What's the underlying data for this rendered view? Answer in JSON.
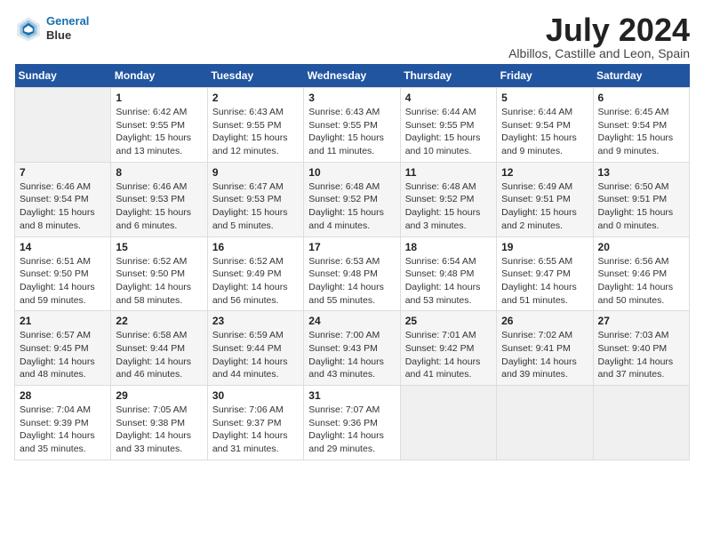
{
  "header": {
    "logo_line1": "General",
    "logo_line2": "Blue",
    "month_title": "July 2024",
    "location": "Albillos, Castille and Leon, Spain"
  },
  "days_of_week": [
    "Sunday",
    "Monday",
    "Tuesday",
    "Wednesday",
    "Thursday",
    "Friday",
    "Saturday"
  ],
  "weeks": [
    [
      {
        "day": "",
        "info": ""
      },
      {
        "day": "1",
        "info": "Sunrise: 6:42 AM\nSunset: 9:55 PM\nDaylight: 15 hours\nand 13 minutes."
      },
      {
        "day": "2",
        "info": "Sunrise: 6:43 AM\nSunset: 9:55 PM\nDaylight: 15 hours\nand 12 minutes."
      },
      {
        "day": "3",
        "info": "Sunrise: 6:43 AM\nSunset: 9:55 PM\nDaylight: 15 hours\nand 11 minutes."
      },
      {
        "day": "4",
        "info": "Sunrise: 6:44 AM\nSunset: 9:55 PM\nDaylight: 15 hours\nand 10 minutes."
      },
      {
        "day": "5",
        "info": "Sunrise: 6:44 AM\nSunset: 9:54 PM\nDaylight: 15 hours\nand 9 minutes."
      },
      {
        "day": "6",
        "info": "Sunrise: 6:45 AM\nSunset: 9:54 PM\nDaylight: 15 hours\nand 9 minutes."
      }
    ],
    [
      {
        "day": "7",
        "info": "Sunrise: 6:46 AM\nSunset: 9:54 PM\nDaylight: 15 hours\nand 8 minutes."
      },
      {
        "day": "8",
        "info": "Sunrise: 6:46 AM\nSunset: 9:53 PM\nDaylight: 15 hours\nand 6 minutes."
      },
      {
        "day": "9",
        "info": "Sunrise: 6:47 AM\nSunset: 9:53 PM\nDaylight: 15 hours\nand 5 minutes."
      },
      {
        "day": "10",
        "info": "Sunrise: 6:48 AM\nSunset: 9:52 PM\nDaylight: 15 hours\nand 4 minutes."
      },
      {
        "day": "11",
        "info": "Sunrise: 6:48 AM\nSunset: 9:52 PM\nDaylight: 15 hours\nand 3 minutes."
      },
      {
        "day": "12",
        "info": "Sunrise: 6:49 AM\nSunset: 9:51 PM\nDaylight: 15 hours\nand 2 minutes."
      },
      {
        "day": "13",
        "info": "Sunrise: 6:50 AM\nSunset: 9:51 PM\nDaylight: 15 hours\nand 0 minutes."
      }
    ],
    [
      {
        "day": "14",
        "info": "Sunrise: 6:51 AM\nSunset: 9:50 PM\nDaylight: 14 hours\nand 59 minutes."
      },
      {
        "day": "15",
        "info": "Sunrise: 6:52 AM\nSunset: 9:50 PM\nDaylight: 14 hours\nand 58 minutes."
      },
      {
        "day": "16",
        "info": "Sunrise: 6:52 AM\nSunset: 9:49 PM\nDaylight: 14 hours\nand 56 minutes."
      },
      {
        "day": "17",
        "info": "Sunrise: 6:53 AM\nSunset: 9:48 PM\nDaylight: 14 hours\nand 55 minutes."
      },
      {
        "day": "18",
        "info": "Sunrise: 6:54 AM\nSunset: 9:48 PM\nDaylight: 14 hours\nand 53 minutes."
      },
      {
        "day": "19",
        "info": "Sunrise: 6:55 AM\nSunset: 9:47 PM\nDaylight: 14 hours\nand 51 minutes."
      },
      {
        "day": "20",
        "info": "Sunrise: 6:56 AM\nSunset: 9:46 PM\nDaylight: 14 hours\nand 50 minutes."
      }
    ],
    [
      {
        "day": "21",
        "info": "Sunrise: 6:57 AM\nSunset: 9:45 PM\nDaylight: 14 hours\nand 48 minutes."
      },
      {
        "day": "22",
        "info": "Sunrise: 6:58 AM\nSunset: 9:44 PM\nDaylight: 14 hours\nand 46 minutes."
      },
      {
        "day": "23",
        "info": "Sunrise: 6:59 AM\nSunset: 9:44 PM\nDaylight: 14 hours\nand 44 minutes."
      },
      {
        "day": "24",
        "info": "Sunrise: 7:00 AM\nSunset: 9:43 PM\nDaylight: 14 hours\nand 43 minutes."
      },
      {
        "day": "25",
        "info": "Sunrise: 7:01 AM\nSunset: 9:42 PM\nDaylight: 14 hours\nand 41 minutes."
      },
      {
        "day": "26",
        "info": "Sunrise: 7:02 AM\nSunset: 9:41 PM\nDaylight: 14 hours\nand 39 minutes."
      },
      {
        "day": "27",
        "info": "Sunrise: 7:03 AM\nSunset: 9:40 PM\nDaylight: 14 hours\nand 37 minutes."
      }
    ],
    [
      {
        "day": "28",
        "info": "Sunrise: 7:04 AM\nSunset: 9:39 PM\nDaylight: 14 hours\nand 35 minutes."
      },
      {
        "day": "29",
        "info": "Sunrise: 7:05 AM\nSunset: 9:38 PM\nDaylight: 14 hours\nand 33 minutes."
      },
      {
        "day": "30",
        "info": "Sunrise: 7:06 AM\nSunset: 9:37 PM\nDaylight: 14 hours\nand 31 minutes."
      },
      {
        "day": "31",
        "info": "Sunrise: 7:07 AM\nSunset: 9:36 PM\nDaylight: 14 hours\nand 29 minutes."
      },
      {
        "day": "",
        "info": ""
      },
      {
        "day": "",
        "info": ""
      },
      {
        "day": "",
        "info": ""
      }
    ]
  ]
}
